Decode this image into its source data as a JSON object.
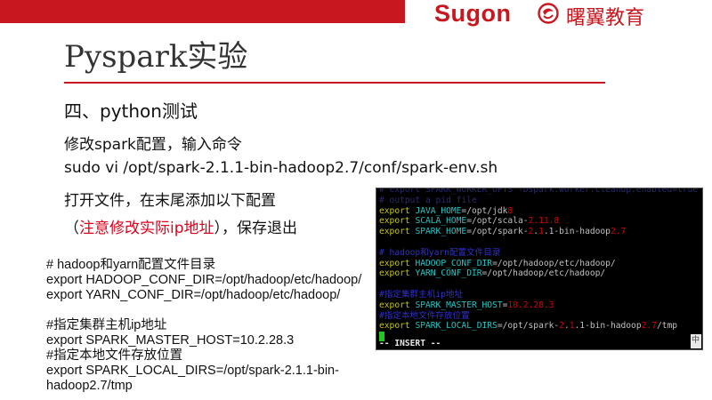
{
  "header": {
    "brand": "Sugon",
    "brand_cn": "曙翼教育",
    "brand_color": "#c8171e"
  },
  "slide": {
    "title": "Pyspark实验",
    "section": "四、python测试",
    "step1": "修改spark配置，输入命令",
    "command": "sudo vi /opt/spark-2.1.1-bin-hadoop2.7/conf/spark-env.sh",
    "step2": "打开文件，在末尾添加以下配置",
    "note_open": "（",
    "note_warn": "注意修改实际ip地址",
    "note_close": "），保存退出"
  },
  "config_lines": [
    "# hadoop和yarn配置文件目录",
    "export HADOOP_CONF_DIR=/opt/hadoop/etc/hadoop/",
    "export YARN_CONF_DIR=/opt/hadoop/etc/hadoop/",
    "",
    "#指定集群主机ip地址",
    "export SPARK_MASTER_HOST=10.2.28.3",
    "#指定本地文件存放位置",
    "export SPARK_LOCAL_DIRS=/opt/spark-2.1.1-bin-",
    "hadoop2.7/tmp"
  ],
  "terminal": {
    "dim1": "# export SPARK_WORKER_OPTS -Dspark.worker.cleanup.enabled=true",
    "dim2": "# output a pid file",
    "lines": [
      [
        [
          "kw",
          "export "
        ],
        [
          "var",
          "JAVA_HOME"
        ],
        [
          "val",
          "=/opt/jdk"
        ],
        [
          "num",
          "8"
        ]
      ],
      [
        [
          "kw",
          "export "
        ],
        [
          "var",
          "SCALA_HOME"
        ],
        [
          "val",
          "=/opt/scala-"
        ],
        [
          "num",
          "2.11.8"
        ]
      ],
      [
        [
          "kw",
          "export "
        ],
        [
          "var",
          "SPARK_HOME"
        ],
        [
          "val",
          "=/opt/spark-"
        ],
        [
          "num",
          "2"
        ],
        [
          "val",
          "."
        ],
        [
          "num",
          "1"
        ],
        [
          "val",
          ".1-bin-hadoop"
        ],
        [
          "num",
          "2.7"
        ]
      ],
      [],
      [
        [
          "comment",
          "# hadoop和yarn配置文件目录"
        ]
      ],
      [
        [
          "kw",
          "export "
        ],
        [
          "var",
          "HADOOP_CONF_DIR"
        ],
        [
          "val",
          "=/opt/hadoop/etc/hadoop/"
        ]
      ],
      [
        [
          "kw",
          "export "
        ],
        [
          "var",
          "YARN_CONF_DIR"
        ],
        [
          "val",
          "=/opt/hadoop/etc/hadoop/"
        ]
      ],
      [],
      [
        [
          "comment",
          "#指定集群主机ip地址"
        ]
      ],
      [
        [
          "kw",
          "export "
        ],
        [
          "var",
          "SPARK_MASTER_HOST"
        ],
        [
          "val",
          "="
        ],
        [
          "num",
          "10.2.28.3"
        ]
      ],
      [
        [
          "comment",
          "#指定本地文件存放位置"
        ]
      ],
      [
        [
          "kw",
          "export "
        ],
        [
          "var",
          "SPARK_LOCAL_DIRS"
        ],
        [
          "val",
          "=/opt/spark-"
        ],
        [
          "num",
          "2"
        ],
        [
          "val",
          "."
        ],
        [
          "num",
          "1"
        ],
        [
          "val",
          ".1-bin-hadoop"
        ],
        [
          "num",
          "2.7"
        ],
        [
          "val",
          "/tmp"
        ]
      ]
    ],
    "mode": "-- INSERT --",
    "scroll_glyph": "中"
  }
}
